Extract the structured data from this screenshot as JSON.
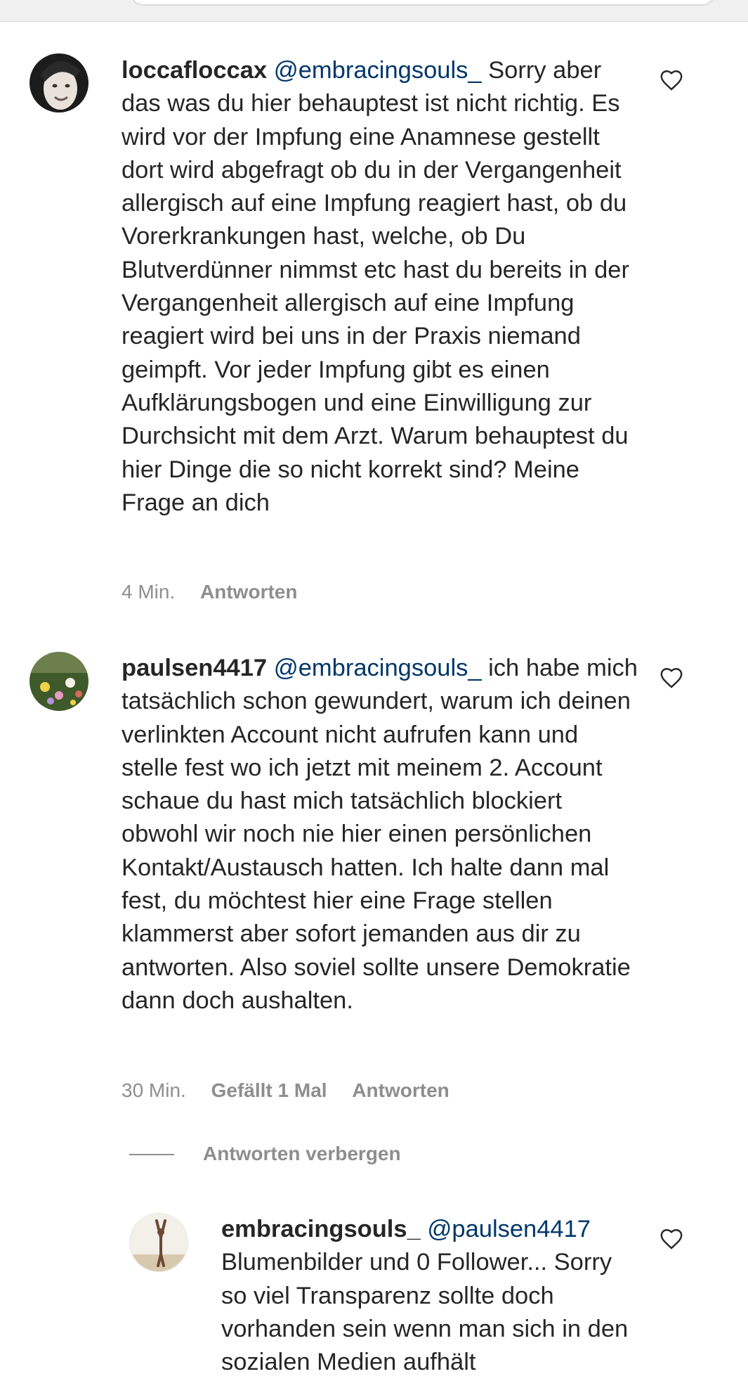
{
  "comments": [
    {
      "username": "loccafloccax",
      "mention": "@embracingsouls_",
      "text": " Sorry aber das was du hier behauptest ist nicht richtig. Es wird vor der Impfung eine Anamnese gestellt dort wird abgefragt ob du in der Vergangenheit allergisch auf eine Impfung reagiert hast, ob du Vorerkrankungen hast, welche, ob Du Blutverdünner nimmst etc hast du bereits in der Vergangenheit allergisch auf eine Impfung reagiert wird bei uns in der Praxis niemand geimpft. Vor jeder Impfung gibt es einen Aufklärungsbogen und eine Einwilligung zur Durchsicht mit dem Arzt. Warum behauptest du hier Dinge die so nicht korrekt sind? Meine Frage an dich",
      "time": "4 Min.",
      "reply_label": "Antworten"
    },
    {
      "username": "paulsen4417",
      "mention": "@embracingsouls_",
      "text": " ich habe mich tatsächlich schon gewundert, warum ich deinen verlinkten Account nicht aufrufen kann und stelle fest wo ich jetzt mit meinem 2. Account schaue du hast mich tatsächlich blockiert obwohl wir noch nie hier einen persönlichen Kontakt/Austausch hatten. Ich halte dann mal fest, du möchtest hier eine Frage stellen klammerst aber sofort jemanden aus dir zu antworten. Also soviel sollte unsere Demokratie dann doch aushalten.",
      "time": "30 Min.",
      "likes": "Gefällt 1 Mal",
      "reply_label": "Antworten",
      "hide_replies": "Antworten verbergen"
    },
    {
      "username": "embracingsouls_",
      "mention": "@paulsen4417",
      "text": " Blumenbilder und 0 Follower... Sorry so viel Transparenz sollte doch vorhanden sein wenn man sich in den sozialen Medien aufhält"
    }
  ],
  "icons": {
    "like": "heart-outline-icon"
  },
  "colors": {
    "mention": "#00376b",
    "meta": "#8e8e8e",
    "text": "#262626"
  }
}
